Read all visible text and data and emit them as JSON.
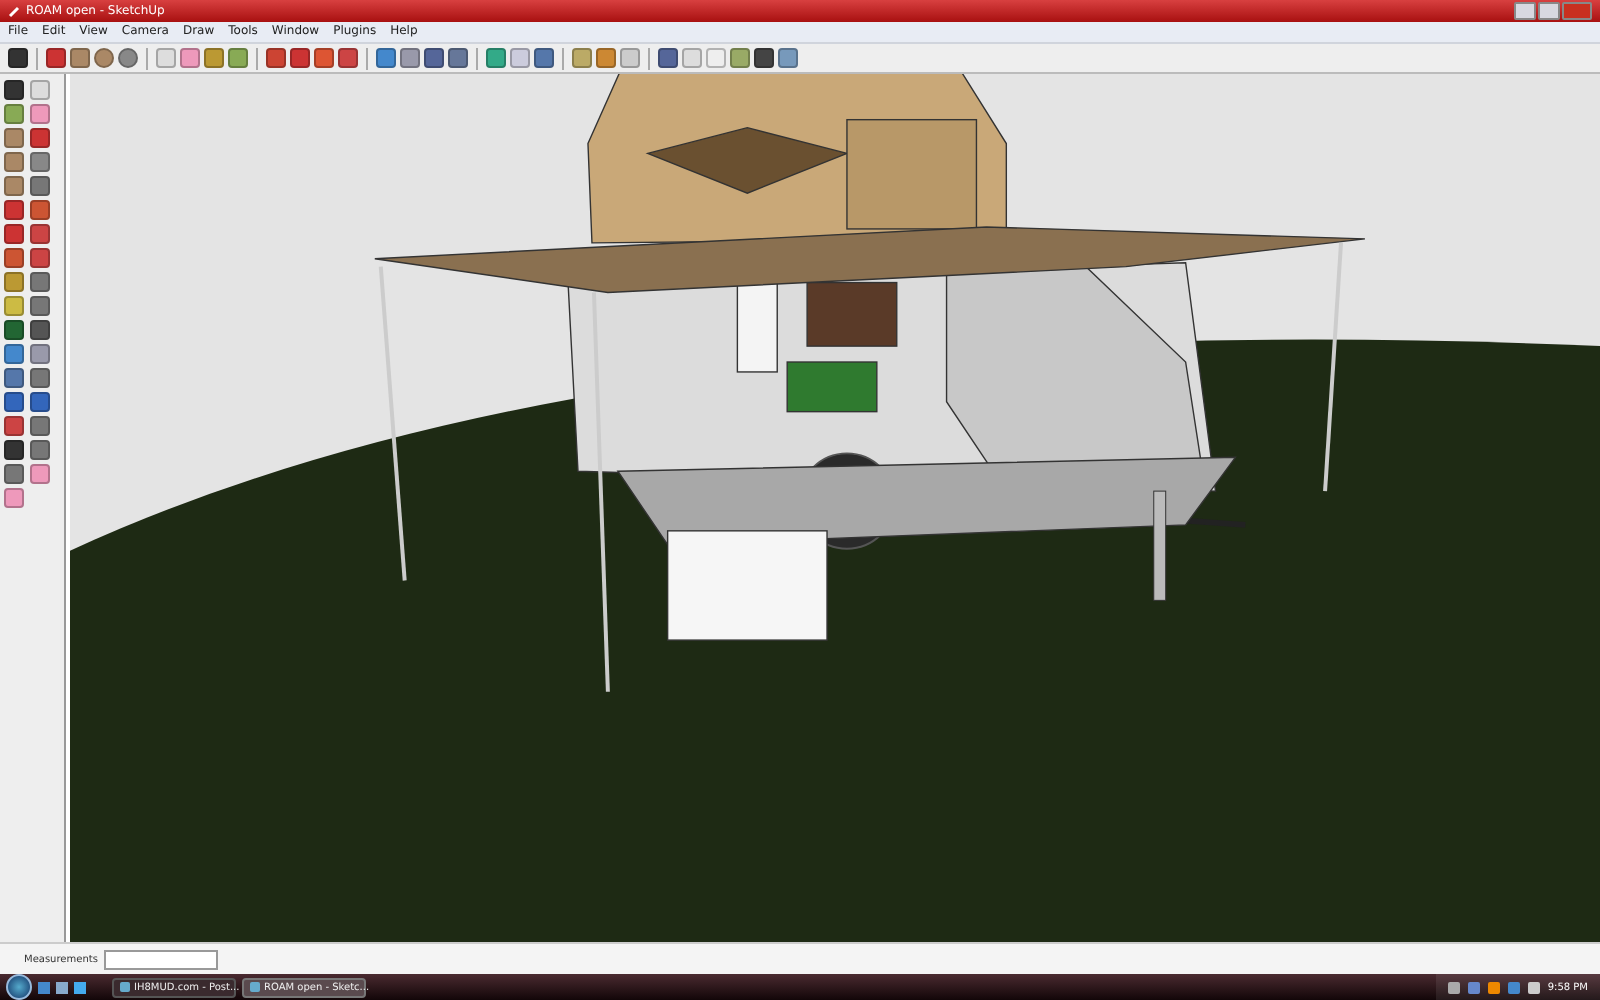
{
  "window": {
    "title": "ROAM open - SketchUp"
  },
  "menu": [
    "File",
    "Edit",
    "View",
    "Camera",
    "Draw",
    "Tools",
    "Window",
    "Plugins",
    "Help"
  ],
  "status_bar": {
    "measurements_label": "Measurements"
  },
  "taskbar": {
    "items": [
      {
        "label": "IH8MUD.com - Post...",
        "selected": false
      },
      {
        "label": "ROAM open - Sketc...",
        "selected": true
      }
    ],
    "clock": "9:58 PM"
  }
}
